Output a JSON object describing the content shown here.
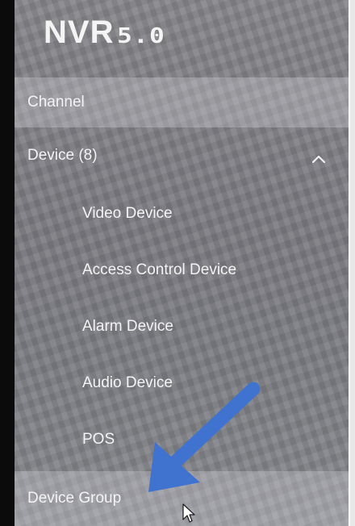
{
  "logo": {
    "text": "NVR",
    "version": "5.0"
  },
  "nav": {
    "channel": "Channel",
    "device": {
      "label": "Device (8)",
      "expanded": true,
      "icon": "chevron-up-icon",
      "children": [
        "Video Device",
        "Access Control Device",
        "Alarm Device",
        "Audio Device",
        "POS"
      ]
    },
    "device_group": "Device Group"
  },
  "colors": {
    "panel": "#7f8085",
    "text": "#f4f4f4",
    "annotation_arrow": "#3f73cf"
  },
  "icons": {
    "annotation": "arrow-icon",
    "pointer": "mouse-cursor-icon"
  }
}
